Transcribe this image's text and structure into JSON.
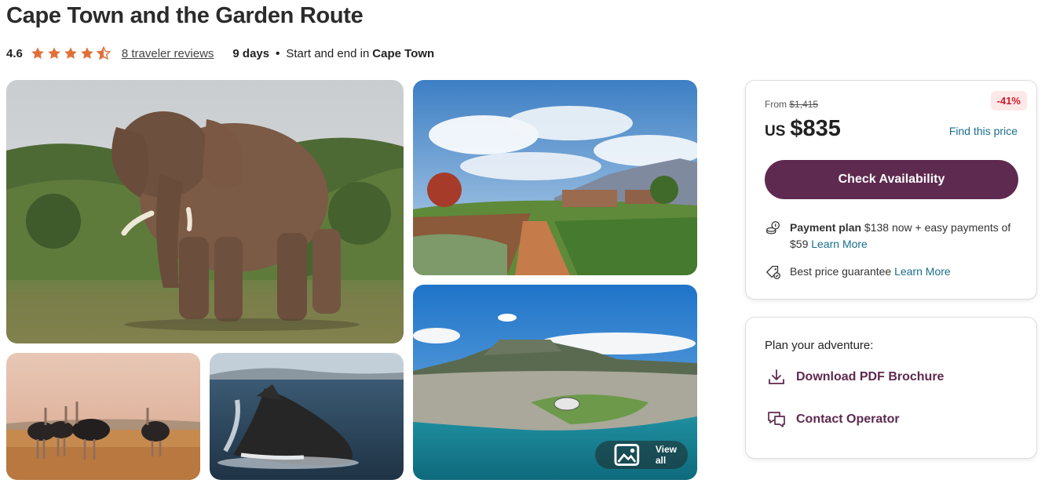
{
  "title": "Cape Town and the Garden Route",
  "meta": {
    "rating": "4.6",
    "stars": 4.5,
    "reviews": "8 traveler reviews",
    "duration": "9 days",
    "separator": "•",
    "start_end_prefix": "Start and end in",
    "start_end_place": "Cape Town"
  },
  "gallery": {
    "view_all": "View all"
  },
  "pricing": {
    "from_label": "From",
    "original_price": "$1,415",
    "discount": "-41%",
    "currency": "US",
    "price": "$835",
    "find_price": "Find this price",
    "cta": "Check Availability",
    "payment_plan_label": "Payment plan",
    "payment_plan_text": "$138 now + easy payments of $59",
    "learn_more": "Learn More",
    "guarantee_text": "Best price guarantee",
    "guarantee_learn_more": "Learn More"
  },
  "adventure": {
    "title": "Plan your adventure:",
    "download": "Download PDF Brochure",
    "contact": "Contact Operator"
  },
  "colors": {
    "brand": "#5e2a4f",
    "link": "#1a6e8c",
    "star": "#e0703a",
    "discount": "#d11a2a"
  }
}
